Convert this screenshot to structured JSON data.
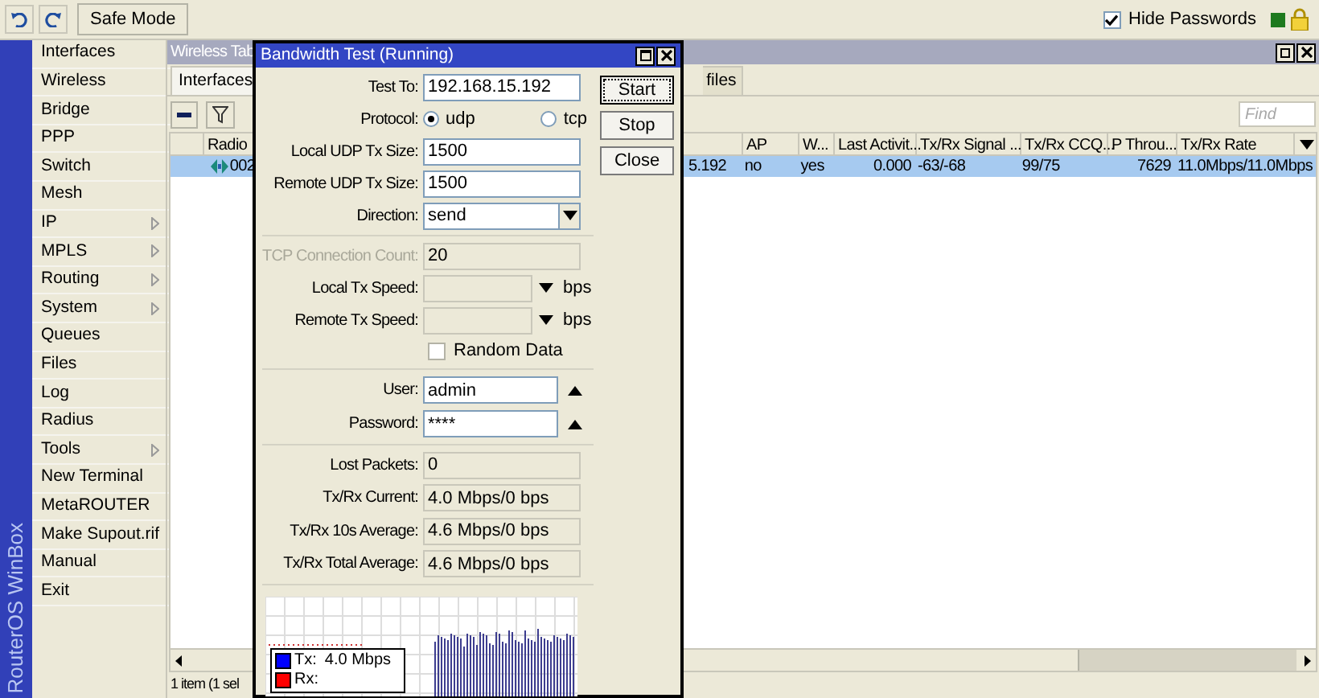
{
  "toolbar": {
    "safe_mode": "Safe Mode",
    "hide_passwords": {
      "label": "Hide Passwords",
      "checked": true
    }
  },
  "sidebar": {
    "brand": "RouterOS WinBox",
    "items": [
      {
        "label": "Interfaces",
        "submenu": false
      },
      {
        "label": "Wireless",
        "submenu": false
      },
      {
        "label": "Bridge",
        "submenu": false
      },
      {
        "label": "PPP",
        "submenu": false
      },
      {
        "label": "Switch",
        "submenu": false
      },
      {
        "label": "Mesh",
        "submenu": false
      },
      {
        "label": "IP",
        "submenu": true
      },
      {
        "label": "MPLS",
        "submenu": true
      },
      {
        "label": "Routing",
        "submenu": true
      },
      {
        "label": "System",
        "submenu": true
      },
      {
        "label": "Queues",
        "submenu": false
      },
      {
        "label": "Files",
        "submenu": false
      },
      {
        "label": "Log",
        "submenu": false
      },
      {
        "label": "Radius",
        "submenu": false
      },
      {
        "label": "Tools",
        "submenu": true
      },
      {
        "label": "New Terminal",
        "submenu": false
      },
      {
        "label": "MetaROUTER",
        "submenu": false
      },
      {
        "label": "Make Supout.rif",
        "submenu": false
      },
      {
        "label": "Manual",
        "submenu": false
      },
      {
        "label": "Exit",
        "submenu": false
      }
    ]
  },
  "wireless_window": {
    "title": "Wireless Tab",
    "tabs": [
      {
        "label": "Interfaces",
        "selected": true
      },
      {
        "label": "files",
        "selected": false
      }
    ],
    "find": {
      "placeholder": "Find"
    },
    "columns": [
      "Radio",
      "",
      "AP",
      "W...",
      "Last Activit...",
      "Tx/Rx Signal ...",
      "Tx/Rx CCQ...",
      "P Throu...",
      "Tx/Rx Rate"
    ],
    "rows": [
      {
        "selected": true,
        "cells": [
          "002",
          "5.192",
          "no",
          "yes",
          "0.000",
          "-63/-68",
          "99/75",
          "7629",
          "11.0Mbps/11.0Mbps"
        ]
      }
    ],
    "status": "1 item (1 sel"
  },
  "dialog": {
    "title": "Bandwidth Test (Running)",
    "groups": [
      [
        {
          "kind": "text",
          "label": "Test To:",
          "value": "192.168.15.192"
        },
        {
          "kind": "radio",
          "label": "Protocol:",
          "options": [
            {
              "label": "udp",
              "selected": true
            },
            {
              "label": "tcp",
              "selected": false
            }
          ]
        },
        {
          "kind": "text",
          "label": "Local UDP Tx Size:",
          "value": "1500"
        },
        {
          "kind": "text",
          "label": "Remote UDP Tx Size:",
          "value": "1500"
        },
        {
          "kind": "select",
          "label": "Direction:",
          "value": "send"
        }
      ],
      [
        {
          "kind": "text",
          "label": "TCP Connection Count:",
          "value": "20",
          "disabled": true
        },
        {
          "kind": "speed",
          "label": "Local Tx Speed:",
          "unit": "bps"
        },
        {
          "kind": "speed",
          "label": "Remote Tx Speed:",
          "unit": "bps"
        },
        {
          "kind": "checkbox",
          "label": "Random Data",
          "checked": false
        }
      ],
      [
        {
          "kind": "credential",
          "label": "User:",
          "value": "admin"
        },
        {
          "kind": "credential",
          "label": "Password:",
          "value": "****"
        }
      ],
      [
        {
          "kind": "readonly",
          "label": "Lost Packets:",
          "value": "0"
        },
        {
          "kind": "readonly",
          "label": "Tx/Rx Current:",
          "value": "4.0 Mbps/0 bps"
        },
        {
          "kind": "readonly",
          "label": "Tx/Rx 10s Average:",
          "value": "4.6 Mbps/0 bps"
        },
        {
          "kind": "readonly",
          "label": "Tx/Rx Total Average:",
          "value": "4.6 Mbps/0 bps"
        }
      ]
    ],
    "buttons": [
      {
        "label": "Start",
        "focused": true
      },
      {
        "label": "Stop",
        "focused": false
      },
      {
        "label": "Close",
        "focused": false
      }
    ],
    "legend": [
      {
        "label": "Tx:",
        "reading": "4.0 Mbps",
        "color": "#0000ff"
      },
      {
        "label": "Rx:",
        "color": "#ff0000"
      }
    ]
  }
}
